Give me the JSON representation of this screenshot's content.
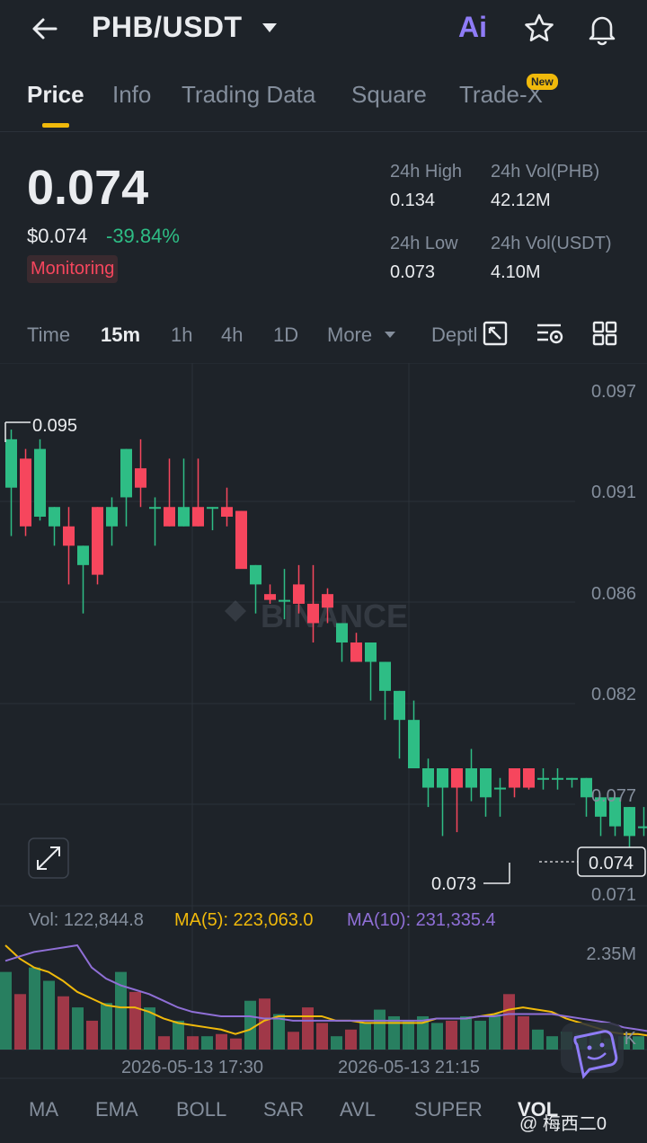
{
  "header": {
    "pair": "PHB/USDT",
    "ai_label": "Ai",
    "icons": [
      "back-arrow-icon",
      "caret-down-icon",
      "star-icon",
      "bell-icon"
    ]
  },
  "tabs": [
    {
      "label": "Price",
      "active": true
    },
    {
      "label": "Info"
    },
    {
      "label": "Trading Data"
    },
    {
      "label": "Square"
    },
    {
      "label": "Trade-X",
      "badge": "New"
    }
  ],
  "price": {
    "last": "0.074",
    "usd": "$0.074",
    "change": "-39.84%",
    "tag": "Monitoring"
  },
  "stats": {
    "high_label": "24h High",
    "high": "0.134",
    "vol_base_label": "24h Vol(PHB)",
    "vol_base": "42.12M",
    "low_label": "24h Low",
    "low": "0.073",
    "vol_quote_label": "24h Vol(USDT)",
    "vol_quote": "4.10M"
  },
  "timeframes": [
    "Time",
    "15m",
    "1h",
    "4h",
    "1D",
    "More",
    "Depth"
  ],
  "active_timeframe": "15m",
  "chart": {
    "brand_watermark": "BINANCE",
    "y_ticks": [
      "0.097",
      "0.091",
      "0.086",
      "0.082",
      "0.077",
      "0.071"
    ],
    "high_marker": "0.095",
    "low_marker": "0.073",
    "current_price": "0.074",
    "vol_text": "Vol: 122,844.8",
    "ma5_text": "MA(5): 223,063.0",
    "ma10_text": "MA(10): 231,335.4",
    "vol_tick": "2.35M",
    "vol_tick_partial": "K",
    "x_ticks": [
      "2026-05-13 17:30",
      "2026-05-13 21:15"
    ],
    "colors": {
      "up": "#2ebd85",
      "down": "#f6465d",
      "ma5": "#f0b90b",
      "ma10": "#8f6fd6"
    },
    "candles": [
      [
        0.092,
        0.095,
        0.0895,
        0.0945
      ],
      [
        0.0935,
        0.094,
        0.0895,
        0.09
      ],
      [
        0.0905,
        0.0945,
        0.0903,
        0.094
      ],
      [
        0.09,
        0.091,
        0.089,
        0.091
      ],
      [
        0.09,
        0.091,
        0.087,
        0.089
      ],
      [
        0.088,
        0.089,
        0.0855,
        0.089
      ],
      [
        0.091,
        0.091,
        0.087,
        0.0875
      ],
      [
        0.09,
        0.0915,
        0.089,
        0.091
      ],
      [
        0.0915,
        0.094,
        0.09,
        0.094
      ],
      [
        0.093,
        0.0945,
        0.091,
        0.092
      ],
      [
        0.091,
        0.0915,
        0.089,
        0.091
      ],
      [
        0.091,
        0.0935,
        0.09,
        0.09
      ],
      [
        0.09,
        0.0935,
        0.09,
        0.091
      ],
      [
        0.091,
        0.0935,
        0.09,
        0.09
      ],
      [
        0.091,
        0.091,
        0.0898,
        0.091
      ],
      [
        0.091,
        0.092,
        0.09,
        0.0905
      ],
      [
        0.0908,
        0.0908,
        0.088,
        0.0878
      ],
      [
        0.087,
        0.088,
        0.0855,
        0.088
      ],
      [
        0.0865,
        0.087,
        0.086,
        0.0862
      ],
      [
        0.0862,
        0.0878,
        0.0852,
        0.0862
      ],
      [
        0.087,
        0.088,
        0.0855,
        0.086
      ],
      [
        0.086,
        0.088,
        0.084,
        0.085
      ],
      [
        0.0865,
        0.0868,
        0.085,
        0.0858
      ],
      [
        0.084,
        0.085,
        0.083,
        0.085
      ],
      [
        0.084,
        0.0845,
        0.083,
        0.083
      ],
      [
        0.083,
        0.0835,
        0.081,
        0.084
      ],
      [
        0.0815,
        0.083,
        0.08,
        0.083
      ],
      [
        0.08,
        0.0815,
        0.078,
        0.0815
      ],
      [
        0.0775,
        0.081,
        0.0775,
        0.08
      ],
      [
        0.0765,
        0.078,
        0.0755,
        0.0775
      ],
      [
        0.0765,
        0.0775,
        0.074,
        0.0775
      ],
      [
        0.0775,
        0.0775,
        0.0742,
        0.0765
      ],
      [
        0.0765,
        0.0785,
        0.0758,
        0.0775
      ],
      [
        0.076,
        0.0775,
        0.075,
        0.0775
      ],
      [
        0.0765,
        0.077,
        0.075,
        0.0765
      ],
      [
        0.0775,
        0.0775,
        0.076,
        0.0765
      ],
      [
        0.0775,
        0.0775,
        0.0764,
        0.0765
      ],
      [
        0.077,
        0.0775,
        0.0764,
        0.077
      ],
      [
        0.077,
        0.0775,
        0.0764,
        0.077
      ],
      [
        0.077,
        0.077,
        0.0765,
        0.077
      ],
      [
        0.076,
        0.077,
        0.075,
        0.077
      ],
      [
        0.075,
        0.076,
        0.074,
        0.076
      ],
      [
        0.0745,
        0.076,
        0.074,
        0.076
      ],
      [
        0.074,
        0.0755,
        0.073,
        0.0755
      ],
      [
        0.0745,
        0.0755,
        0.074,
        0.0745
      ],
      [
        0.0745,
        0.0755,
        0.074,
        0.0745
      ],
      [
        0.0742,
        0.0745,
        0.074,
        0.0742
      ]
    ],
    "volumes": [
      1.75,
      1.25,
      1.85,
      1.55,
      1.2,
      0.95,
      0.65,
      1.05,
      1.75,
      1.3,
      0.95,
      0.3,
      0.65,
      0.3,
      0.3,
      0.35,
      0.25,
      1.1,
      1.15,
      0.8,
      0.4,
      0.95,
      0.6,
      0.3,
      0.45,
      0.6,
      0.9,
      0.75,
      0.65,
      0.75,
      0.6,
      0.65,
      0.75,
      0.65,
      0.8,
      1.25,
      0.75,
      0.45,
      0.3,
      0.4,
      0.35,
      0.4,
      0.25,
      0.3,
      0.3,
      0.15,
      0.1
    ],
    "ma5": [
      2.35,
      2.05,
      1.85,
      1.75,
      1.55,
      1.3,
      1.15,
      1.0,
      0.95,
      0.95,
      0.85,
      0.7,
      0.6,
      0.55,
      0.5,
      0.45,
      0.35,
      0.45,
      0.65,
      0.75,
      0.75,
      0.75,
      0.75,
      0.65,
      0.65,
      0.6,
      0.6,
      0.6,
      0.6,
      0.6,
      0.7,
      0.7,
      0.7,
      0.75,
      0.8,
      0.9,
      0.95,
      0.9,
      0.85,
      0.7,
      0.6,
      0.5,
      0.4,
      0.35,
      0.35,
      0.3,
      0.25
    ],
    "ma10": [
      2.0,
      2.1,
      2.2,
      2.25,
      2.3,
      2.35,
      1.85,
      1.6,
      1.45,
      1.35,
      1.25,
      1.1,
      0.95,
      0.85,
      0.8,
      0.75,
      0.75,
      0.75,
      0.7,
      0.7,
      0.65,
      0.65,
      0.65,
      0.65,
      0.65,
      0.65,
      0.65,
      0.65,
      0.65,
      0.65,
      0.7,
      0.7,
      0.7,
      0.75,
      0.75,
      0.8,
      0.8,
      0.8,
      0.8,
      0.75,
      0.7,
      0.65,
      0.6,
      0.5,
      0.45,
      0.4,
      0.35
    ]
  },
  "indicators": [
    "MA",
    "EMA",
    "BOLL",
    "SAR",
    "AVL",
    "SUPER",
    "VOL"
  ],
  "active_indicator": "VOL",
  "watermark_user": "@ 梅西二0"
}
